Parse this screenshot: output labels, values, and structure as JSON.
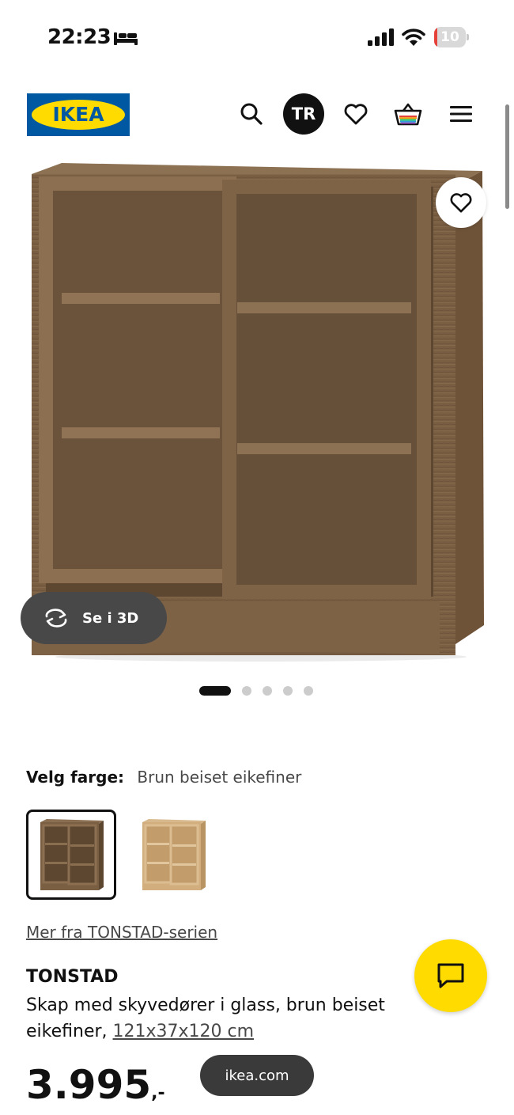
{
  "status_bar": {
    "time": "22:23",
    "battery_level": "10",
    "battery_fraction": 0.1,
    "icons": [
      "bed-icon",
      "signal-icon",
      "wifi-icon",
      "battery-icon"
    ]
  },
  "header": {
    "logo_text": "IKEA",
    "profile_initials": "TR",
    "icons": [
      "search-icon",
      "heart-icon",
      "shopping-bag-icon",
      "menu-icon"
    ]
  },
  "gallery": {
    "view_3d_label": "Se i 3D",
    "image_count": 5,
    "active_index": 0,
    "icons": [
      "heart-icon",
      "rotate-3d-icon"
    ]
  },
  "color_selector": {
    "heading": "Velg farge:",
    "selected_value": "Brun beiset eikefiner",
    "options_count": 2
  },
  "product": {
    "series_link": "Mer fra TONSTAD-serien",
    "name": "TONSTAD",
    "description": "Skap med skyvedører i glass, brun beiset eikefiner,",
    "dimensions": "121x37x120 cm",
    "price_main": "3.995",
    "price_suffix": ",-"
  },
  "overlay": {
    "url": "ikea.com",
    "icons": [
      "chat-icon"
    ]
  },
  "colors": {
    "ikea_blue": "#0058a3",
    "ikea_yellow": "#ffdb00",
    "battery_low": "#e5433a"
  }
}
